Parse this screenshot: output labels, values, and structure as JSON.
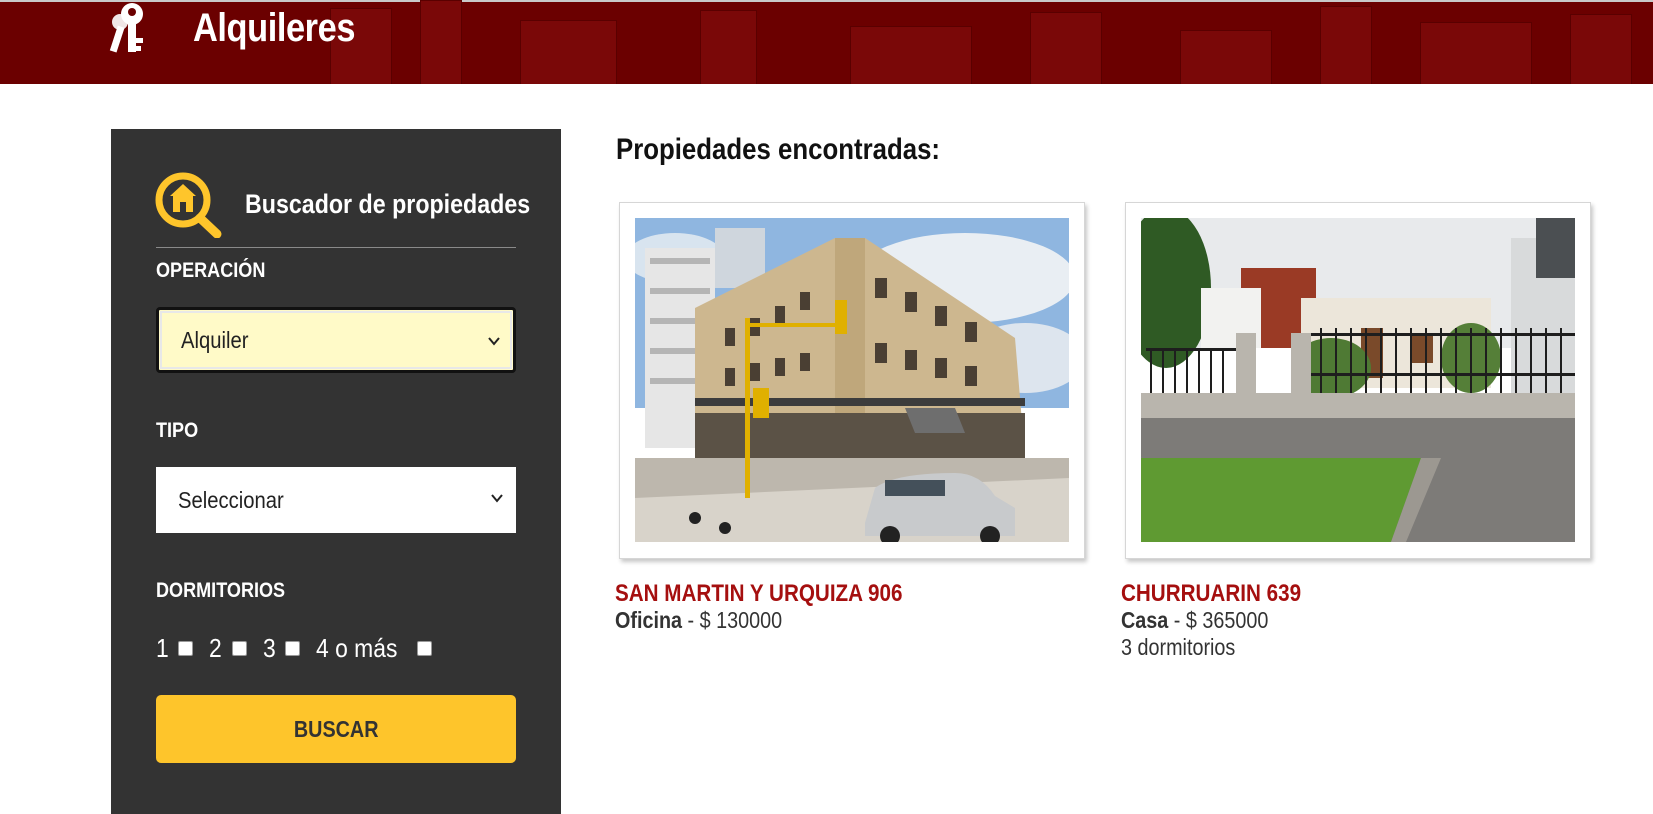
{
  "header": {
    "title": "Alquileres",
    "icon": "keys-icon",
    "background": "#6b0000"
  },
  "sidebar": {
    "title": "Buscador de propiedades",
    "icon": "house-search-icon",
    "operacion": {
      "label": "OPERACIÓN",
      "value": "Alquiler"
    },
    "tipo": {
      "label": "TIPO",
      "value": "Seleccionar"
    },
    "dormitorios": {
      "label": "DORMITORIOS",
      "options": [
        "1",
        "2",
        "3",
        "4 o más"
      ],
      "checked": [
        false,
        false,
        false,
        false
      ]
    },
    "button_label": "BUSCAR",
    "accent": "#fec52b",
    "background": "#333333"
  },
  "main": {
    "title": "Propiedades encontradas:",
    "properties": [
      {
        "address": "SAN MARTIN Y URQUIZA 906",
        "type": "Oficina",
        "price": "- $ 130000",
        "extra": ""
      },
      {
        "address": "CHURRUARIN 639",
        "type": "Casa",
        "price": "- $ 365000",
        "extra": "3 dormitorios"
      }
    ],
    "address_color": "#a50f0f"
  }
}
